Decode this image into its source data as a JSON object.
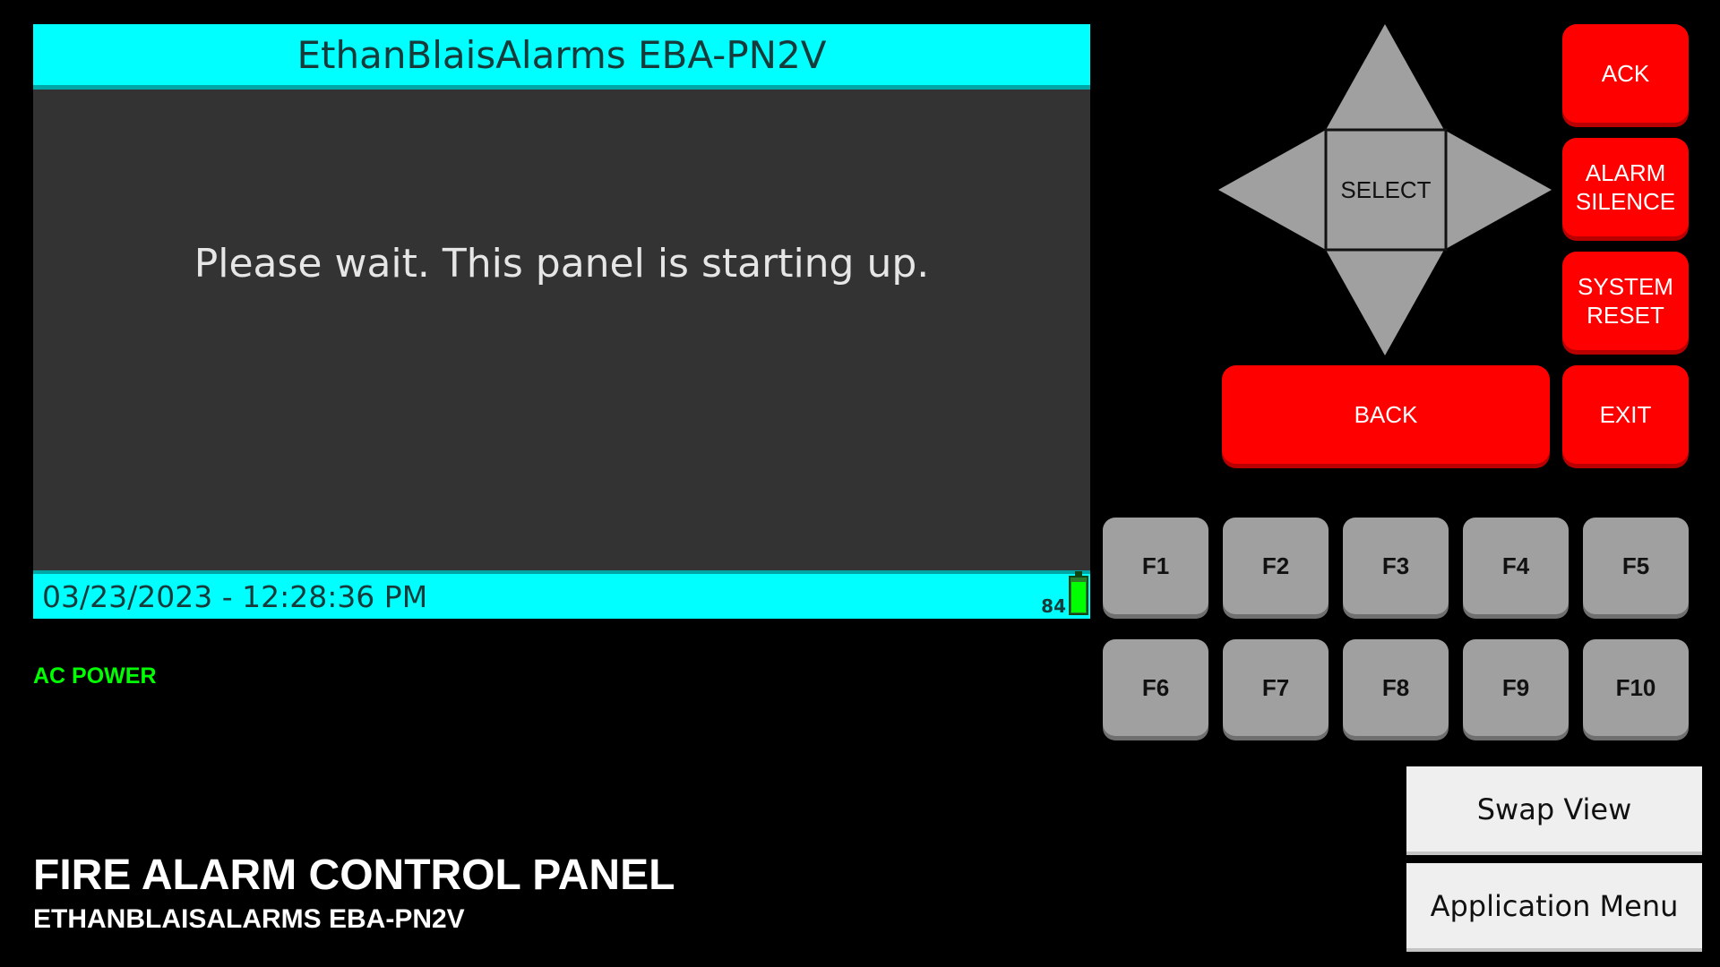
{
  "lcd": {
    "title": "EthanBlaisAlarms EBA-PN2V",
    "message": "Please wait. This panel is starting up.",
    "datetime": "03/23/2023 - 12:28:36 PM",
    "battery_percent": "84",
    "battery_level": 0.84
  },
  "status": {
    "ac_power": "AC POWER"
  },
  "footer": {
    "title": "FIRE ALARM CONTROL PANEL",
    "subtitle": "ETHANBLAISALARMS EBA-PN2V"
  },
  "dpad": {
    "select_label": "SELECT"
  },
  "buttons": {
    "ack": "ACK",
    "alarm_silence": "ALARM\nSILENCE",
    "system_reset": "SYSTEM\nRESET",
    "back": "BACK",
    "exit": "EXIT"
  },
  "function_keys": [
    "F1",
    "F2",
    "F3",
    "F4",
    "F5",
    "F6",
    "F7",
    "F8",
    "F9",
    "F10"
  ],
  "app_buttons": {
    "swap_view": "Swap View",
    "application_menu": "Application Menu"
  },
  "colors": {
    "lcd_bar": "#00ffff",
    "lcd_background": "#333333",
    "red_button": "#ff0000",
    "function_key": "#a0a0a0",
    "ac_power": "#00ff00"
  }
}
